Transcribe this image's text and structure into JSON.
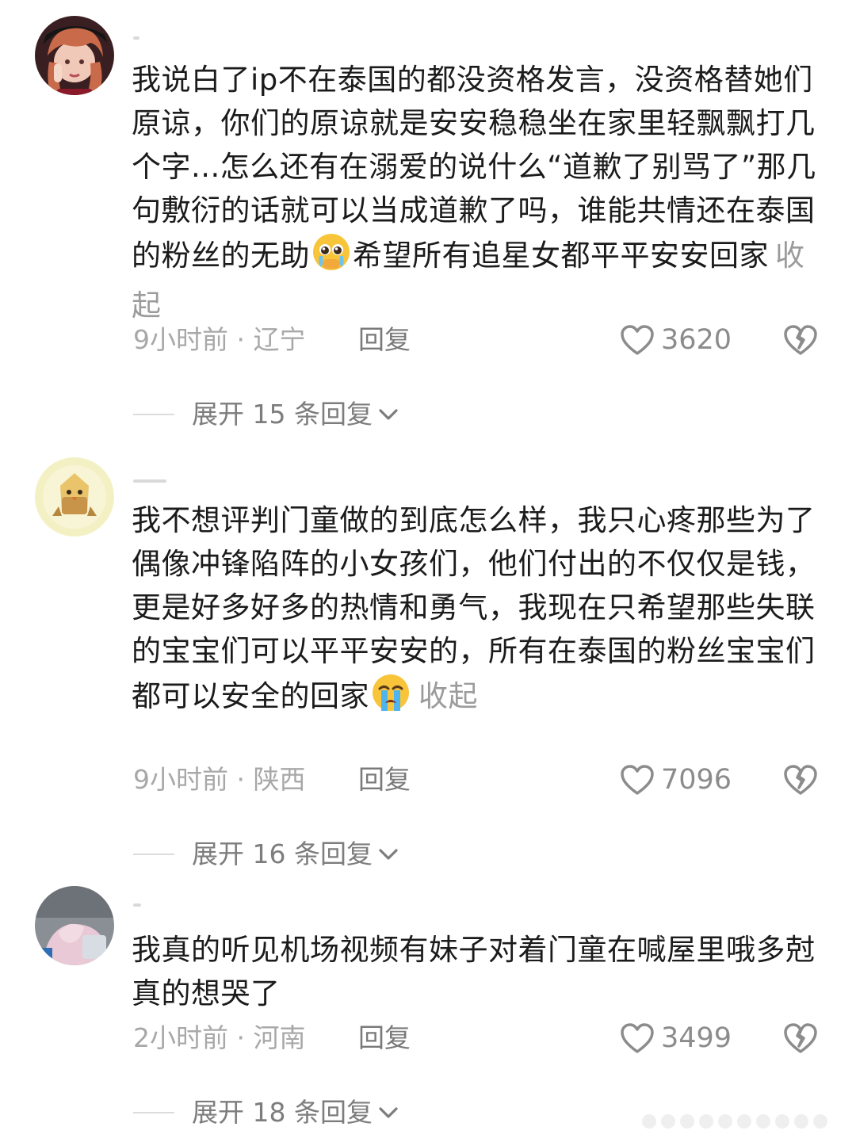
{
  "comments": [
    {
      "text_before_emoji": "我说白了ip不在泰国的都没资格发言，没资格替她们原谅，你们的原谅就是安安稳稳坐在家里轻飘飘打几个字...怎么还有在溺爱的说什么“道歉了别骂了”那几句敷衍的话就可以当成道歉了吗，谁能共情还在泰国的粉丝的无助",
      "emoji": "pleading-face-icon",
      "text_after_emoji": "希望所有追星女都平平安安回家",
      "collapse_label": "收起",
      "meta": "9小时前 · 辽宁",
      "reply_label": "回复",
      "likes": "3620",
      "expand_label": "展开 15 条回复"
    },
    {
      "text_before_emoji": "我不想评判门童做的到底怎么样，我只心疼那些为了偶像冲锋陷阵的小女孩们，他们付出的不仅仅是钱，更是好多好多的热情和勇气，我现在只希望那些失联的宝宝们可以平平安安的，所有在泰国的粉丝宝宝们都可以安全的回家",
      "emoji": "crying-face-icon",
      "text_after_emoji": "",
      "collapse_label": "收起",
      "meta": "9小时前 · 陕西",
      "reply_label": "回复",
      "likes": "7096",
      "expand_label": "展开 16 条回复"
    },
    {
      "text_before_emoji": "我真的听见机场视频有妹子对着门童在喊屋里哦多尅真的想哭了",
      "emoji": "",
      "text_after_emoji": "",
      "collapse_label": "",
      "meta": "2小时前 · 河南",
      "reply_label": "回复",
      "likes": "3499",
      "expand_label": "展开 18 条回复"
    }
  ],
  "colors": {
    "text": "#1b1b1b",
    "meta": "#a8a8a8",
    "reply": "#7a7a7a",
    "expand": "#7d7d7d"
  }
}
